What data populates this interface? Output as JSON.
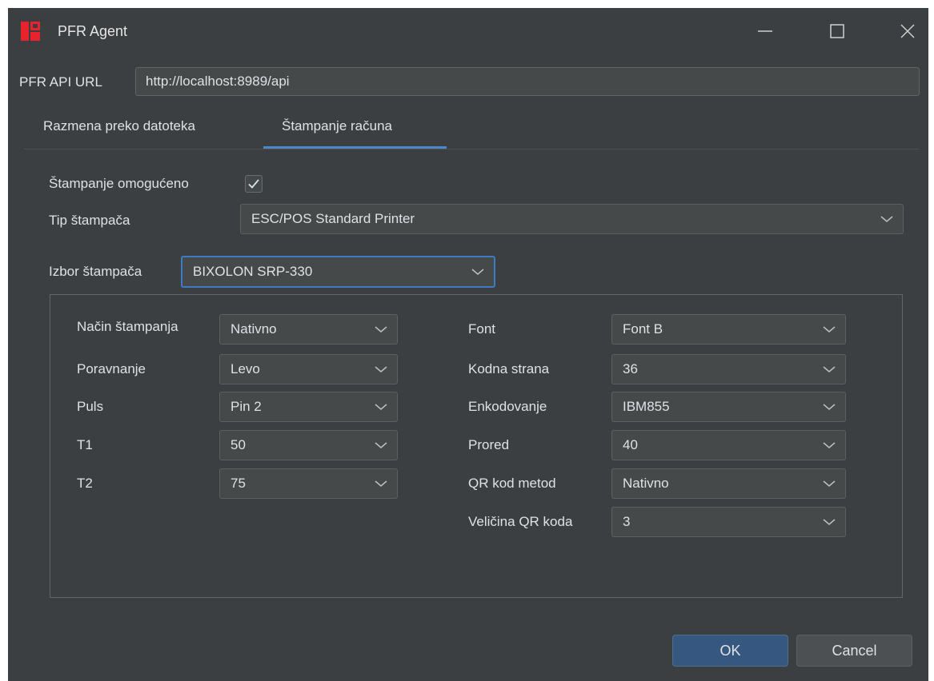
{
  "window": {
    "title": "PFR Agent"
  },
  "api": {
    "label": "PFR API URL",
    "value": "http://localhost:8989/api"
  },
  "tabs": [
    {
      "label": "Razmena preko datoteka",
      "active": false
    },
    {
      "label": "Štampanje računa",
      "active": true
    }
  ],
  "printing": {
    "enabled_label": "Štampanje omogućeno",
    "enabled": true,
    "printer_type_label": "Tip štampača",
    "printer_type_value": "ESC/POS Standard Printer",
    "printer_select_label": "Izbor štampača",
    "printer_select_value": "BIXOLON SRP-330"
  },
  "settings": {
    "left": [
      {
        "label": "Način štampanja",
        "value": "Nativno"
      },
      {
        "label": "Poravnanje",
        "value": "Levo"
      },
      {
        "label": "Puls",
        "value": "Pin 2"
      },
      {
        "label": "T1",
        "value": "50"
      },
      {
        "label": "T2",
        "value": "75"
      }
    ],
    "right": [
      {
        "label": "Font",
        "value": "Font B"
      },
      {
        "label": "Kodna strana",
        "value": "36"
      },
      {
        "label": "Enkodovanje",
        "value": "IBM855"
      },
      {
        "label": "Prored",
        "value": "40"
      },
      {
        "label": "QR kod metod",
        "value": "Nativno"
      },
      {
        "label": "Veličina QR koda",
        "value": "3"
      }
    ]
  },
  "buttons": {
    "ok": "OK",
    "cancel": "Cancel"
  },
  "colors": {
    "accent": "#4a88c7",
    "background": "#3c3f41",
    "logo": "#e8232d"
  }
}
